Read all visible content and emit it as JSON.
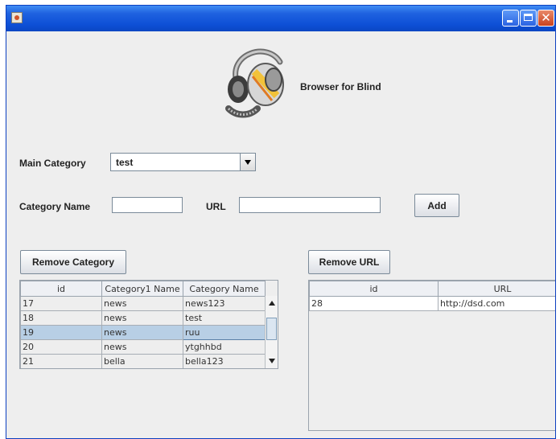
{
  "app": {
    "brand_text": "Browser for Blind"
  },
  "window": {
    "titlebar_color": "#0d4fd6"
  },
  "form": {
    "main_category_label": "Main Category",
    "main_category_value": "test",
    "category_name_label": "Category Name",
    "category_name_value": "",
    "url_label": "URL",
    "url_value": "",
    "add_button": "Add"
  },
  "category_table": {
    "remove_button": "Remove Category",
    "columns": [
      "id",
      "Category1 Name",
      "Category Name"
    ],
    "rows": [
      [
        "17",
        "news",
        "news123"
      ],
      [
        "18",
        "news",
        "test"
      ],
      [
        "19",
        "news",
        "ruu"
      ],
      [
        "20",
        "news",
        "ytghhbd"
      ],
      [
        "21",
        "bella",
        "bella123"
      ]
    ],
    "selected_row": 2
  },
  "url_table": {
    "remove_button": "Remove URL",
    "columns": [
      "id",
      "URL"
    ],
    "rows": [
      [
        "28",
        "http://dsd.com"
      ]
    ]
  },
  "icons": [
    "app-icon",
    "minimize-icon",
    "maximize-icon",
    "close-icon",
    "headphones-logo-icon",
    "dropdown-arrow-icon",
    "scroll-up-icon",
    "scroll-down-icon"
  ],
  "colors": {
    "selection": "#b8cfe5",
    "window_bg": "#eeeeee"
  }
}
